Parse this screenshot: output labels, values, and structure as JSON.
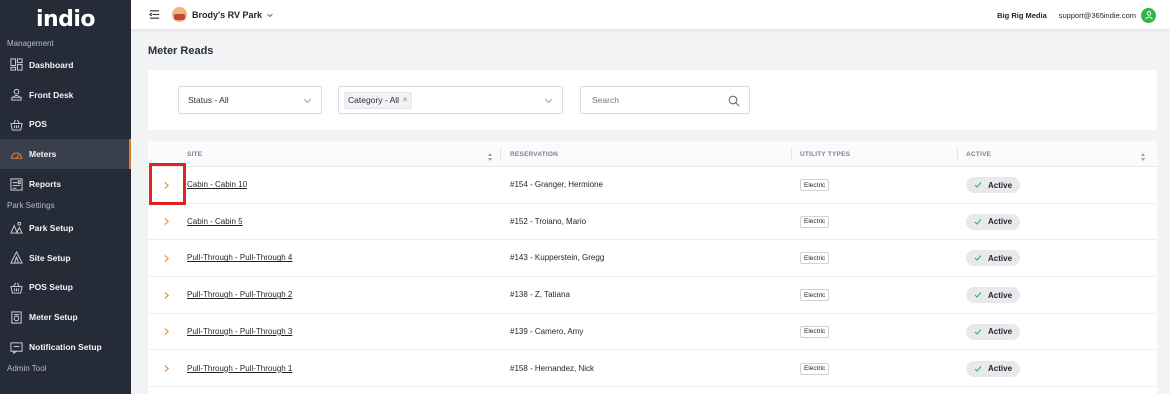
{
  "app": {
    "logo_text": "indio",
    "colors": {
      "accent": "#e07b2a",
      "sidebar_bg": "#262b38",
      "active_check": "#2fb54a",
      "highlight": "#e0241f"
    }
  },
  "sidebar": {
    "sections": [
      {
        "label": "Management",
        "items": [
          {
            "label": "Dashboard",
            "icon": "dashboard-icon"
          },
          {
            "label": "Front Desk",
            "icon": "front-desk-icon"
          },
          {
            "label": "POS",
            "icon": "pos-basket-icon"
          },
          {
            "label": "Meters",
            "icon": "meter-gauge-icon",
            "active": true
          },
          {
            "label": "Reports",
            "icon": "reports-icon"
          }
        ]
      },
      {
        "label": "Park Settings",
        "items": [
          {
            "label": "Park Setup",
            "icon": "park-setup-icon"
          },
          {
            "label": "Site Setup",
            "icon": "site-setup-icon"
          },
          {
            "label": "POS Setup",
            "icon": "pos-setup-icon"
          },
          {
            "label": "Meter Setup",
            "icon": "meter-setup-icon"
          },
          {
            "label": "Notification Setup",
            "icon": "notification-setup-icon"
          }
        ]
      },
      {
        "label": "Admin Tool",
        "items": []
      }
    ]
  },
  "topbar": {
    "park_name": "Brody's RV Park",
    "company": "Big Rig Media",
    "email": "support@365indie.com"
  },
  "page": {
    "title": "Meter Reads",
    "filters": {
      "status_value": "Status - All",
      "category_tag": "Category - All",
      "search_placeholder": "Search"
    },
    "columns": [
      "SITE",
      "RESERVATION",
      "UTILITY TYPES",
      "ACTIVE"
    ],
    "rows": [
      {
        "site": "Cabin - Cabin 10",
        "reservation": "#154 - Granger, Hermione",
        "utility": "Electric",
        "active": "Active"
      },
      {
        "site": "Cabin - Cabin 5",
        "reservation": "#152 - Troiano, Mario",
        "utility": "Electric",
        "active": "Active"
      },
      {
        "site": "Pull-Through - Pull-Through 4",
        "reservation": "#143 - Kupperstein, Gregg",
        "utility": "Electric",
        "active": "Active"
      },
      {
        "site": "Pull-Through - Pull-Through 2",
        "reservation": "#138 - Z, Tatiana",
        "utility": "Electric",
        "active": "Active"
      },
      {
        "site": "Pull-Through - Pull-Through 3",
        "reservation": "#139 - Camero, Amy",
        "utility": "Electric",
        "active": "Active"
      },
      {
        "site": "Pull-Through - Pull-Through 1",
        "reservation": "#158 - Hernandez, Nick",
        "utility": "Electric",
        "active": "Active"
      }
    ]
  }
}
